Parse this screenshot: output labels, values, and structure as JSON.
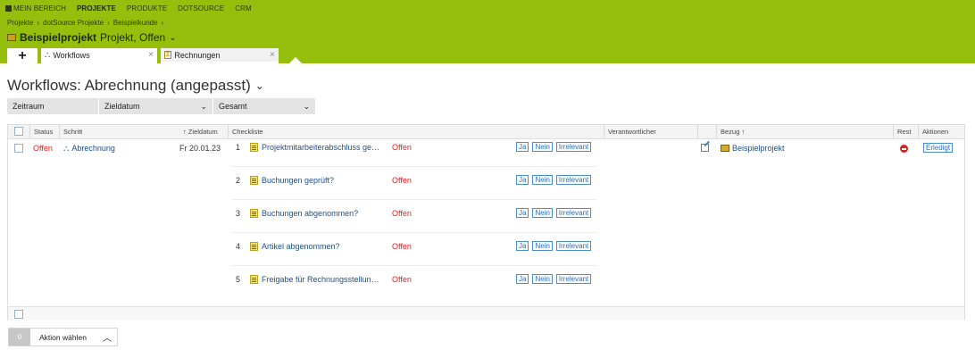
{
  "topnav": [
    "MEIN BEREICH",
    "PROJEKTE",
    "PRODUKTE",
    "DOTSOURCE",
    "CRM"
  ],
  "breadcrumb": [
    "Projekte",
    "dotSource Projekte",
    "Beispielkunde"
  ],
  "project": {
    "name": "Beispielprojekt",
    "subtitle": "Projekt, Offen"
  },
  "tabs": {
    "add": "+",
    "workflows": "Workflows",
    "rechnungen": "Rechnungen"
  },
  "page_title": "Workflows: Abrechnung (angepasst)",
  "filters": [
    "Zeitraum",
    "Zieldatum",
    "Gesamt"
  ],
  "columns": {
    "status": "Status",
    "schritt": "Schritt",
    "zieldatum": "Zieldatum",
    "checkliste": "Checkliste",
    "verantwortlicher": "Verantwortlicher",
    "bezug": "Bezug",
    "rest": "Rest",
    "aktionen": "Aktionen"
  },
  "row": {
    "status": "Offen",
    "schritt": "Abrechnung",
    "zieldatum": "Fr 20.01.23",
    "bezug": "Beispielprojekt",
    "aktion": "Erledigt"
  },
  "tags": {
    "ja": "Ja",
    "nein": "Nein",
    "irrelevant": "Irrelevant"
  },
  "checklist": [
    {
      "nr": "1",
      "text": "Projektmitarbeiterabschluss ge…",
      "status": "Offen"
    },
    {
      "nr": "2",
      "text": "Buchungen geprüft?",
      "status": "Offen"
    },
    {
      "nr": "3",
      "text": "Buchungen abgenommen?",
      "status": "Offen"
    },
    {
      "nr": "4",
      "text": "Artikel abgenommen?",
      "status": "Offen"
    },
    {
      "nr": "5",
      "text": "Freigabe für Rechnungsstellun…",
      "status": "Offen"
    }
  ],
  "action_bar": {
    "count": "0",
    "label": "Aktion wählen"
  },
  "colors": {
    "header": "#96bf0d",
    "status_red": "#e02020",
    "link": "#1f4f86"
  }
}
